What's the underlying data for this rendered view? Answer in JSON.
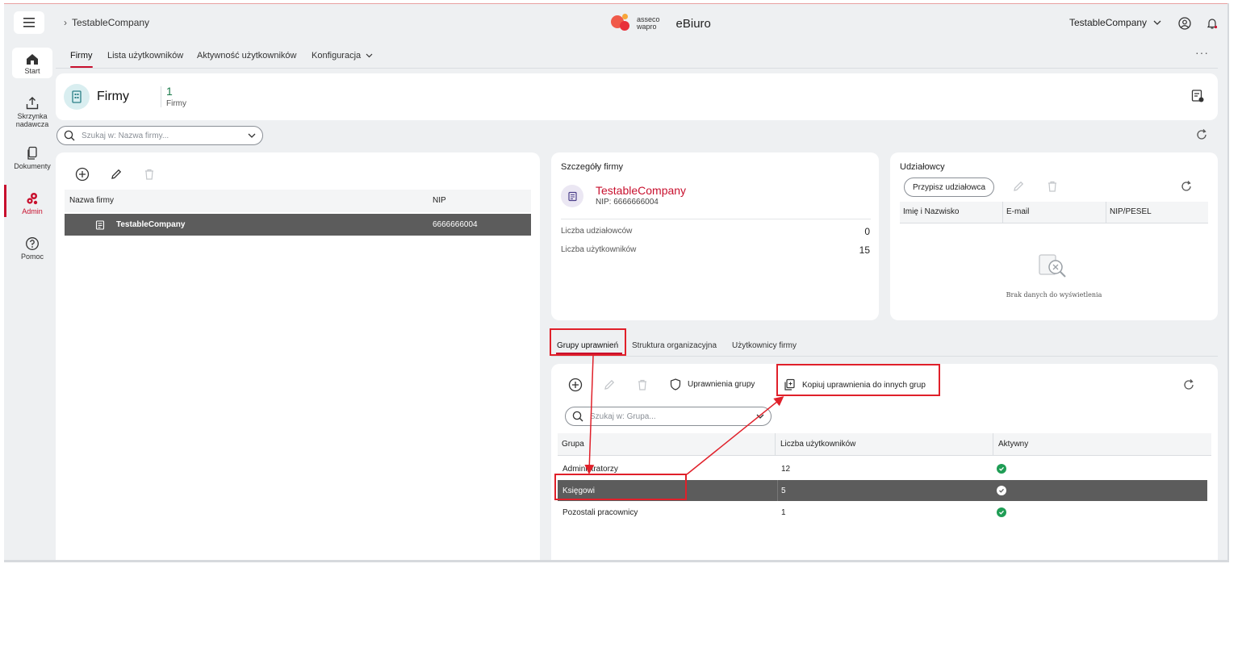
{
  "breadcrumb": {
    "company": "TestableCompany"
  },
  "brand": {
    "line1": "asseco",
    "line2": "wapro",
    "app_name": "eBiuro"
  },
  "topbar": {
    "company_selector": "TestableCompany"
  },
  "sidebar": {
    "items": [
      {
        "label": "Start",
        "icon": "home-icon"
      },
      {
        "label": "Skrzynka nadawcza",
        "icon": "upload-icon"
      },
      {
        "label": "Dokumenty",
        "icon": "documents-icon"
      },
      {
        "label": "Admin",
        "icon": "gears-icon"
      },
      {
        "label": "Pomoc",
        "icon": "help-icon"
      }
    ]
  },
  "nav": {
    "tabs": [
      "Firmy",
      "Lista użytkowników",
      "Aktywność użytkowników",
      "Konfiguracja"
    ],
    "active": "Firmy"
  },
  "header": {
    "title": "Firmy",
    "count": "1",
    "count_label": "Firmy"
  },
  "company_search": {
    "placeholder": "Szukaj w: Nazwa firmy..."
  },
  "companies": {
    "columns": [
      "Nazwa firmy",
      "NIP"
    ],
    "rows": [
      {
        "name": "TestableCompany",
        "nip": "6666666004",
        "selected": true
      }
    ]
  },
  "details": {
    "title": "Szczegóły firmy",
    "company_name": "TestableCompany",
    "nip": "NIP: 6666666004",
    "stats": [
      {
        "label": "Liczba udziałowców",
        "value": "0"
      },
      {
        "label": "Liczba użytkowników",
        "value": "15"
      }
    ]
  },
  "shareholders": {
    "title": "Udziałowcy",
    "assign_button": "Przypisz udziałowca",
    "columns": [
      "Imię i Nazwisko",
      "E-mail",
      "NIP/PESEL"
    ],
    "empty_text": "Brak danych do wyświetlenia"
  },
  "subtabs": [
    "Grupy uprawnień",
    "Struktura organizacyjna",
    "Użytkownicy firmy"
  ],
  "groups_toolbar": {
    "permissions_button": "Uprawnienia grupy",
    "copy_button": "Kopiuj uprawnienia do innych grup"
  },
  "group_search": {
    "placeholder": "Szukaj w: Grupa..."
  },
  "groups": {
    "columns": [
      "Grupa",
      "Liczba użytkowników",
      "Aktywny"
    ],
    "rows": [
      {
        "name": "Administratorzy",
        "users": "12",
        "active": true,
        "selected": false
      },
      {
        "name": "Księgowi",
        "users": "5",
        "active": true,
        "selected": true
      },
      {
        "name": "Pozostali pracownicy",
        "users": "1",
        "active": true,
        "selected": false
      }
    ]
  },
  "colors": {
    "accent": "#c8102e",
    "selected_row": "#5c5c5c",
    "success": "#1f9d55",
    "annotation": "#e0202a"
  }
}
